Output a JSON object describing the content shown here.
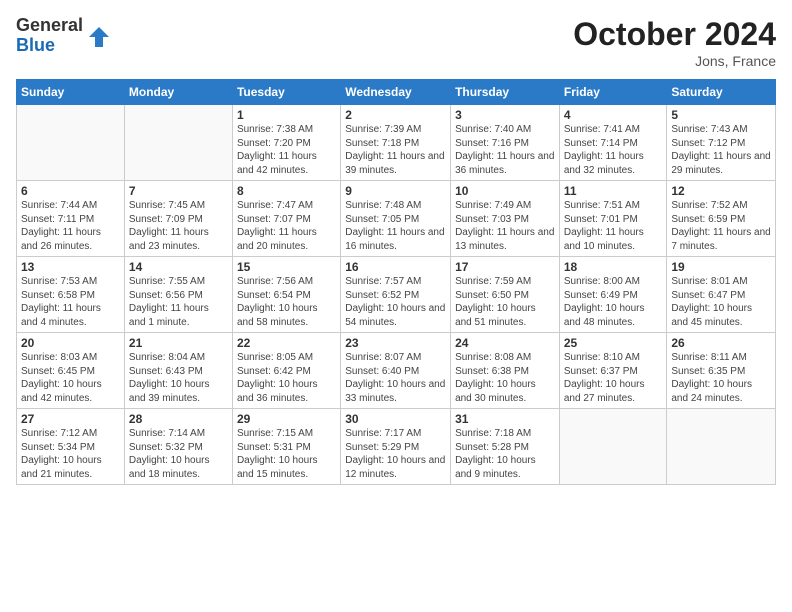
{
  "header": {
    "logo_general": "General",
    "logo_blue": "Blue",
    "month_year": "October 2024",
    "location": "Jons, France"
  },
  "weekdays": [
    "Sunday",
    "Monday",
    "Tuesday",
    "Wednesday",
    "Thursday",
    "Friday",
    "Saturday"
  ],
  "weeks": [
    [
      {
        "day": "",
        "sunrise": "",
        "sunset": "",
        "daylight": ""
      },
      {
        "day": "",
        "sunrise": "",
        "sunset": "",
        "daylight": ""
      },
      {
        "day": "1",
        "sunrise": "Sunrise: 7:38 AM",
        "sunset": "Sunset: 7:20 PM",
        "daylight": "Daylight: 11 hours and 42 minutes."
      },
      {
        "day": "2",
        "sunrise": "Sunrise: 7:39 AM",
        "sunset": "Sunset: 7:18 PM",
        "daylight": "Daylight: 11 hours and 39 minutes."
      },
      {
        "day": "3",
        "sunrise": "Sunrise: 7:40 AM",
        "sunset": "Sunset: 7:16 PM",
        "daylight": "Daylight: 11 hours and 36 minutes."
      },
      {
        "day": "4",
        "sunrise": "Sunrise: 7:41 AM",
        "sunset": "Sunset: 7:14 PM",
        "daylight": "Daylight: 11 hours and 32 minutes."
      },
      {
        "day": "5",
        "sunrise": "Sunrise: 7:43 AM",
        "sunset": "Sunset: 7:12 PM",
        "daylight": "Daylight: 11 hours and 29 minutes."
      }
    ],
    [
      {
        "day": "6",
        "sunrise": "Sunrise: 7:44 AM",
        "sunset": "Sunset: 7:11 PM",
        "daylight": "Daylight: 11 hours and 26 minutes."
      },
      {
        "day": "7",
        "sunrise": "Sunrise: 7:45 AM",
        "sunset": "Sunset: 7:09 PM",
        "daylight": "Daylight: 11 hours and 23 minutes."
      },
      {
        "day": "8",
        "sunrise": "Sunrise: 7:47 AM",
        "sunset": "Sunset: 7:07 PM",
        "daylight": "Daylight: 11 hours and 20 minutes."
      },
      {
        "day": "9",
        "sunrise": "Sunrise: 7:48 AM",
        "sunset": "Sunset: 7:05 PM",
        "daylight": "Daylight: 11 hours and 16 minutes."
      },
      {
        "day": "10",
        "sunrise": "Sunrise: 7:49 AM",
        "sunset": "Sunset: 7:03 PM",
        "daylight": "Daylight: 11 hours and 13 minutes."
      },
      {
        "day": "11",
        "sunrise": "Sunrise: 7:51 AM",
        "sunset": "Sunset: 7:01 PM",
        "daylight": "Daylight: 11 hours and 10 minutes."
      },
      {
        "day": "12",
        "sunrise": "Sunrise: 7:52 AM",
        "sunset": "Sunset: 6:59 PM",
        "daylight": "Daylight: 11 hours and 7 minutes."
      }
    ],
    [
      {
        "day": "13",
        "sunrise": "Sunrise: 7:53 AM",
        "sunset": "Sunset: 6:58 PM",
        "daylight": "Daylight: 11 hours and 4 minutes."
      },
      {
        "day": "14",
        "sunrise": "Sunrise: 7:55 AM",
        "sunset": "Sunset: 6:56 PM",
        "daylight": "Daylight: 11 hours and 1 minute."
      },
      {
        "day": "15",
        "sunrise": "Sunrise: 7:56 AM",
        "sunset": "Sunset: 6:54 PM",
        "daylight": "Daylight: 10 hours and 58 minutes."
      },
      {
        "day": "16",
        "sunrise": "Sunrise: 7:57 AM",
        "sunset": "Sunset: 6:52 PM",
        "daylight": "Daylight: 10 hours and 54 minutes."
      },
      {
        "day": "17",
        "sunrise": "Sunrise: 7:59 AM",
        "sunset": "Sunset: 6:50 PM",
        "daylight": "Daylight: 10 hours and 51 minutes."
      },
      {
        "day": "18",
        "sunrise": "Sunrise: 8:00 AM",
        "sunset": "Sunset: 6:49 PM",
        "daylight": "Daylight: 10 hours and 48 minutes."
      },
      {
        "day": "19",
        "sunrise": "Sunrise: 8:01 AM",
        "sunset": "Sunset: 6:47 PM",
        "daylight": "Daylight: 10 hours and 45 minutes."
      }
    ],
    [
      {
        "day": "20",
        "sunrise": "Sunrise: 8:03 AM",
        "sunset": "Sunset: 6:45 PM",
        "daylight": "Daylight: 10 hours and 42 minutes."
      },
      {
        "day": "21",
        "sunrise": "Sunrise: 8:04 AM",
        "sunset": "Sunset: 6:43 PM",
        "daylight": "Daylight: 10 hours and 39 minutes."
      },
      {
        "day": "22",
        "sunrise": "Sunrise: 8:05 AM",
        "sunset": "Sunset: 6:42 PM",
        "daylight": "Daylight: 10 hours and 36 minutes."
      },
      {
        "day": "23",
        "sunrise": "Sunrise: 8:07 AM",
        "sunset": "Sunset: 6:40 PM",
        "daylight": "Daylight: 10 hours and 33 minutes."
      },
      {
        "day": "24",
        "sunrise": "Sunrise: 8:08 AM",
        "sunset": "Sunset: 6:38 PM",
        "daylight": "Daylight: 10 hours and 30 minutes."
      },
      {
        "day": "25",
        "sunrise": "Sunrise: 8:10 AM",
        "sunset": "Sunset: 6:37 PM",
        "daylight": "Daylight: 10 hours and 27 minutes."
      },
      {
        "day": "26",
        "sunrise": "Sunrise: 8:11 AM",
        "sunset": "Sunset: 6:35 PM",
        "daylight": "Daylight: 10 hours and 24 minutes."
      }
    ],
    [
      {
        "day": "27",
        "sunrise": "Sunrise: 7:12 AM",
        "sunset": "Sunset: 5:34 PM",
        "daylight": "Daylight: 10 hours and 21 minutes."
      },
      {
        "day": "28",
        "sunrise": "Sunrise: 7:14 AM",
        "sunset": "Sunset: 5:32 PM",
        "daylight": "Daylight: 10 hours and 18 minutes."
      },
      {
        "day": "29",
        "sunrise": "Sunrise: 7:15 AM",
        "sunset": "Sunset: 5:31 PM",
        "daylight": "Daylight: 10 hours and 15 minutes."
      },
      {
        "day": "30",
        "sunrise": "Sunrise: 7:17 AM",
        "sunset": "Sunset: 5:29 PM",
        "daylight": "Daylight: 10 hours and 12 minutes."
      },
      {
        "day": "31",
        "sunrise": "Sunrise: 7:18 AM",
        "sunset": "Sunset: 5:28 PM",
        "daylight": "Daylight: 10 hours and 9 minutes."
      },
      {
        "day": "",
        "sunrise": "",
        "sunset": "",
        "daylight": ""
      },
      {
        "day": "",
        "sunrise": "",
        "sunset": "",
        "daylight": ""
      }
    ]
  ]
}
